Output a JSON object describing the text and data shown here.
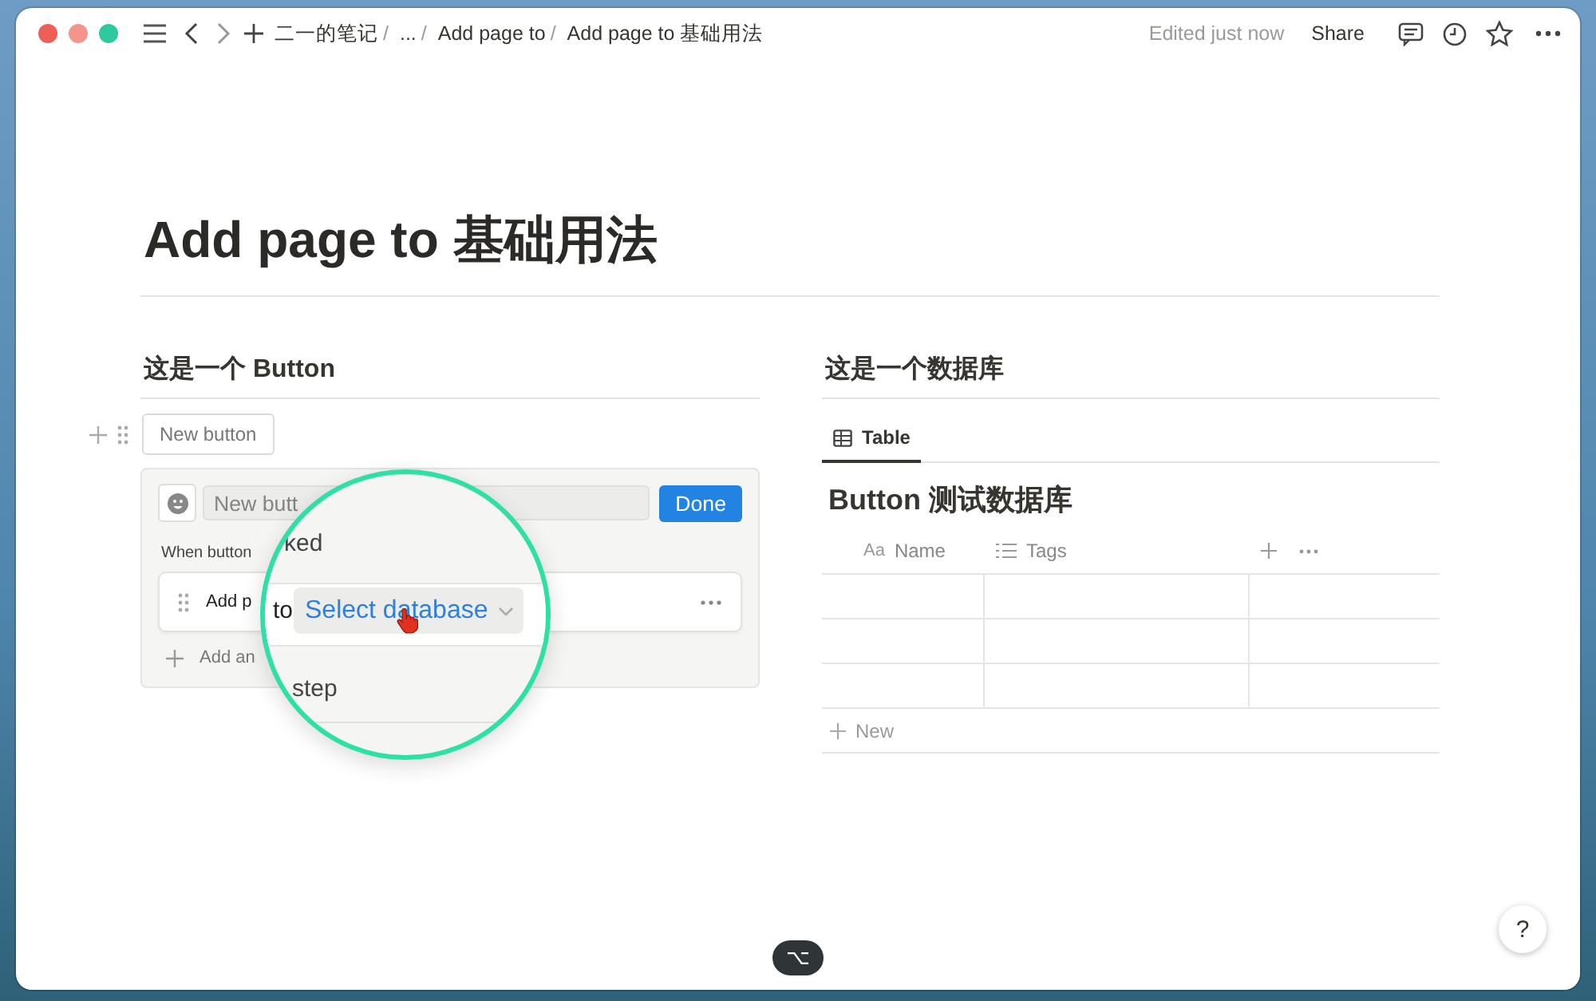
{
  "window": {
    "breadcrumbs": [
      {
        "label": "二一的笔记",
        "separator": "/"
      },
      {
        "label": "...",
        "separator": "/"
      },
      {
        "label": "Add page to",
        "separator": "/"
      },
      {
        "label": "Add page to 基础用法"
      }
    ],
    "edited": "Edited just now",
    "share": "Share"
  },
  "page": {
    "title": "Add page to 基础用法"
  },
  "button_section": {
    "heading": "这是一个 Button",
    "button_label": "New button",
    "editor": {
      "name_placeholder": "New butt",
      "done": "Done",
      "trigger_label": "When button ",
      "step_text": "Add p",
      "add_step": "Add an"
    }
  },
  "magnifier": {
    "trigger_tail": "ked",
    "step_to": "to",
    "database_select": "Select database",
    "add_step_tail": "step"
  },
  "database_section": {
    "heading": "这是一个数据库",
    "tabs": [
      {
        "label": "Table",
        "selected": true
      }
    ],
    "title": "Button 测试数据库",
    "columns": [
      {
        "label": "Name",
        "kind": "title",
        "icon_text": "Aa"
      },
      {
        "label": "Tags",
        "kind": "multi_select"
      }
    ],
    "rows": [
      {
        "kind": "empty"
      },
      {
        "kind": "empty"
      },
      {
        "kind": "empty"
      }
    ],
    "new_row": "New"
  },
  "shortcut_key": "⌥",
  "help": "?"
}
